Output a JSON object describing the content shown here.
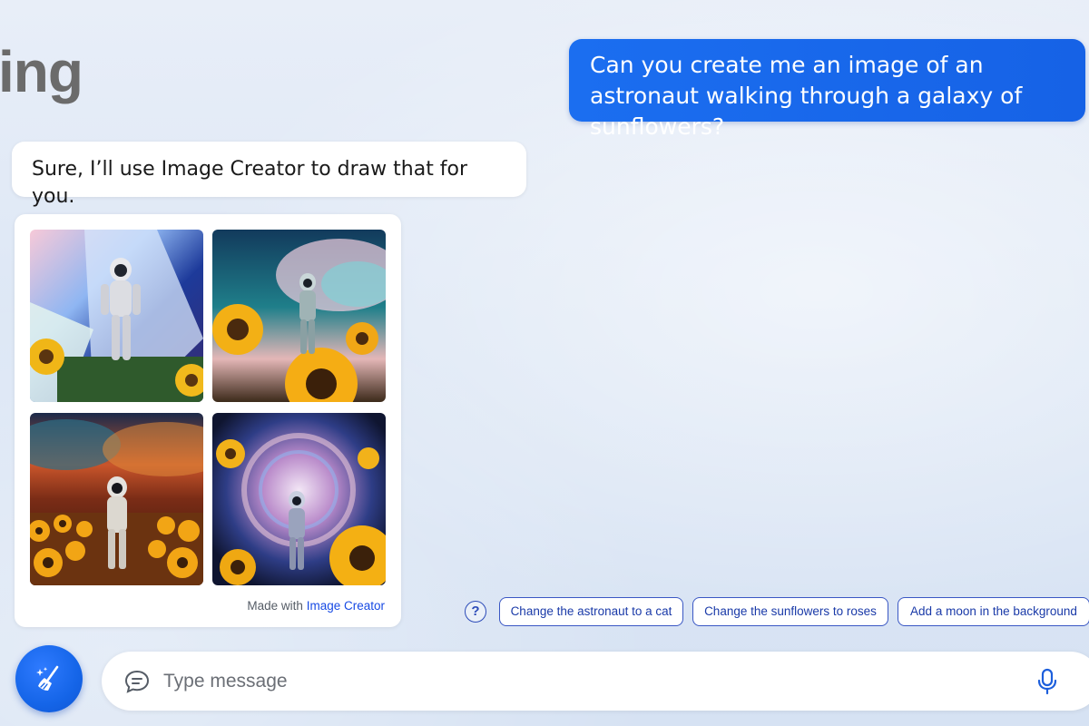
{
  "brand": {
    "text": "ing"
  },
  "conversation": {
    "user_message": "Can you create me an image of an astronaut walking through a galaxy of sunflowers?",
    "bot_message": "Sure, I’ll use Image Creator to draw that for you."
  },
  "image_card": {
    "images": [
      {
        "name": "astronaut-image-1"
      },
      {
        "name": "astronaut-image-2"
      },
      {
        "name": "astronaut-image-3"
      },
      {
        "name": "astronaut-image-4"
      }
    ],
    "caption_prefix": "Made with",
    "caption_link": "Image Creator"
  },
  "suggestions": {
    "help_label": "?",
    "chips": [
      "Change the astronaut to a cat",
      "Change the sunflowers to roses",
      "Add a moon in the background"
    ]
  },
  "composer": {
    "placeholder": "Type message",
    "new_topic_icon": "broom-icon",
    "chat_icon": "chat-bubble-icon",
    "mic_icon": "microphone-icon"
  },
  "colors": {
    "accent": "#1b6ef0",
    "chip_border": "#3a57c4",
    "link": "#174ae4"
  }
}
